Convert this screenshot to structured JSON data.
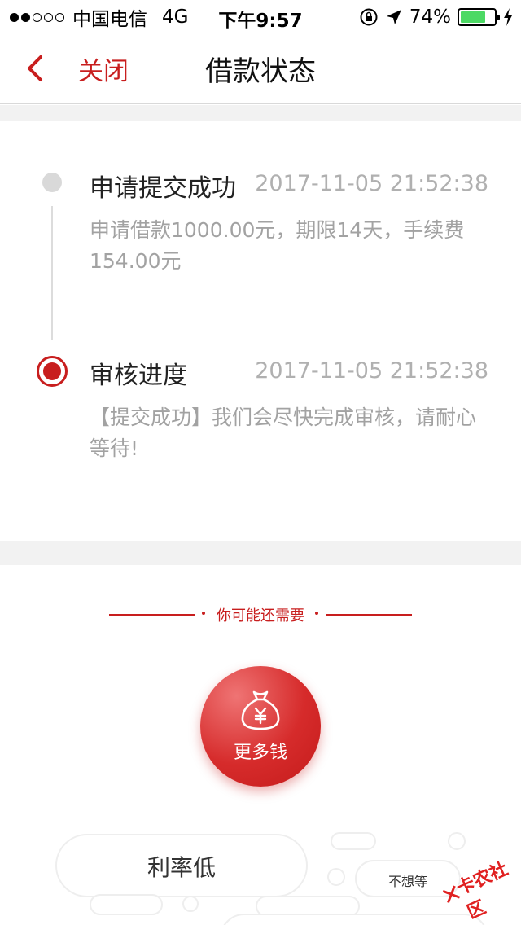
{
  "status_bar": {
    "carrier": "中国电信",
    "network": "4G",
    "time": "下午9:57",
    "battery_percent": "74%",
    "battery_level": 0.74,
    "icons": [
      "signal-dots-icon",
      "rotation-lock-icon",
      "location-arrow-icon",
      "battery-icon",
      "charging-bolt-icon"
    ]
  },
  "nav": {
    "back_icon": "chevron-left-icon",
    "close_label": "关闭",
    "title": "借款状态"
  },
  "timeline": {
    "steps": [
      {
        "title": "申请提交成功",
        "time": "2017-11-05 21:52:38",
        "desc": "申请借款1000.00元，期限14天，手续费154.00元"
      },
      {
        "title": "审核进度",
        "time": "2017-11-05 21:52:38",
        "desc": "【提交成功】我们会尽快完成审核，请耐心等待!"
      }
    ]
  },
  "recommend": {
    "section_label": "你可能还需要",
    "main_button_label": "更多钱",
    "main_button_icon": "money-bag-yen-icon",
    "tags": [
      "利率低",
      "不想等"
    ]
  },
  "watermark": {
    "text": "卡农社区"
  },
  "colors": {
    "accent": "#c81e1e",
    "muted_text": "#a2a2a2",
    "divider": "#f2f2f2"
  }
}
